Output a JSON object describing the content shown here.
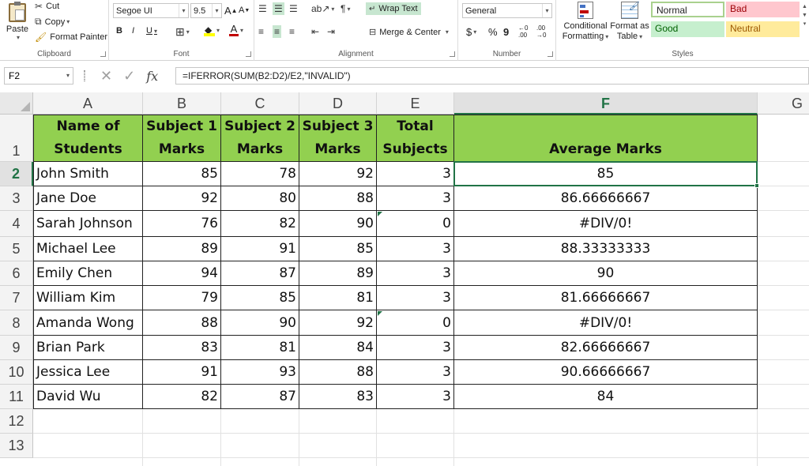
{
  "ribbon": {
    "clipboard": {
      "paste": "Paste",
      "cut": "Cut",
      "copy": "Copy",
      "format_painter": "Format Painter",
      "label": "Clipboard"
    },
    "font": {
      "family": "Segoe UI",
      "size": "9.5",
      "bold": "B",
      "italic": "I",
      "underline": "U",
      "font_color_glyph": "A",
      "grow_glyph": "A",
      "shrink_glyph": "A",
      "label": "Font"
    },
    "alignment": {
      "wrap_text": "Wrap Text",
      "merge_center": "Merge & Center",
      "label": "Alignment"
    },
    "number": {
      "format": "General",
      "currency": "$",
      "percent": "%",
      "comma": "9",
      "inc_decimal": "←0 .00",
      "dec_decimal": ".00 →0",
      "label": "Number"
    },
    "styles": {
      "conditional": [
        "Conditional",
        "Formatting"
      ],
      "format_table": [
        "Format as",
        "Table"
      ],
      "normal": "Normal",
      "bad": "Bad",
      "good": "Good",
      "neutral": "Neutral",
      "label": "Styles",
      "colors": {
        "normal_border": "#a9d18e",
        "bad_bg": "#ffc7ce",
        "bad_fg": "#9c0006",
        "good_bg": "#c6efce",
        "good_fg": "#006100",
        "neutral_bg": "#ffeb9c",
        "neutral_fg": "#9c5700"
      }
    }
  },
  "formula_bar": {
    "name_box": "F2",
    "fx_label": "fx",
    "formula": "=IFERROR(SUM(B2:D2)/E2,\"INVALID\")"
  },
  "sheet": {
    "columns": [
      "A",
      "B",
      "C",
      "D",
      "E",
      "F",
      "G"
    ],
    "active_column": "F",
    "active_row": "2",
    "row_numbers": [
      "1",
      "2",
      "3",
      "4",
      "5",
      "6",
      "7",
      "8",
      "9",
      "10",
      "11",
      "12",
      "13"
    ],
    "header_color": "#92d050",
    "accent_color": "#217346",
    "headers": [
      [
        "Name of",
        "Students"
      ],
      [
        "Subject 1",
        "Marks"
      ],
      [
        "Subject 2",
        "Marks"
      ],
      [
        "Subject 3",
        "Marks"
      ],
      [
        "Total",
        "Subjects"
      ],
      [
        "",
        "Average Marks"
      ]
    ],
    "rows": [
      [
        "John Smith",
        "85",
        "78",
        "92",
        "3",
        "85"
      ],
      [
        "Jane Doe",
        "92",
        "80",
        "88",
        "3",
        "86.66666667"
      ],
      [
        "Sarah Johnson",
        "76",
        "82",
        "90",
        "0",
        "#DIV/0!"
      ],
      [
        "Michael Lee",
        "89",
        "91",
        "85",
        "3",
        "88.33333333"
      ],
      [
        "Emily Chen",
        "94",
        "87",
        "89",
        "3",
        "90"
      ],
      [
        "William Kim",
        "79",
        "85",
        "81",
        "3",
        "81.66666667"
      ],
      [
        "Amanda Wong",
        "88",
        "90",
        "92",
        "0",
        "#DIV/0!"
      ],
      [
        "Brian Park",
        "83",
        "81",
        "84",
        "3",
        "82.66666667"
      ],
      [
        "Jessica Lee",
        "91",
        "93",
        "88",
        "3",
        "90.66666667"
      ],
      [
        "David Wu",
        "82",
        "87",
        "83",
        "3",
        "84"
      ]
    ]
  }
}
